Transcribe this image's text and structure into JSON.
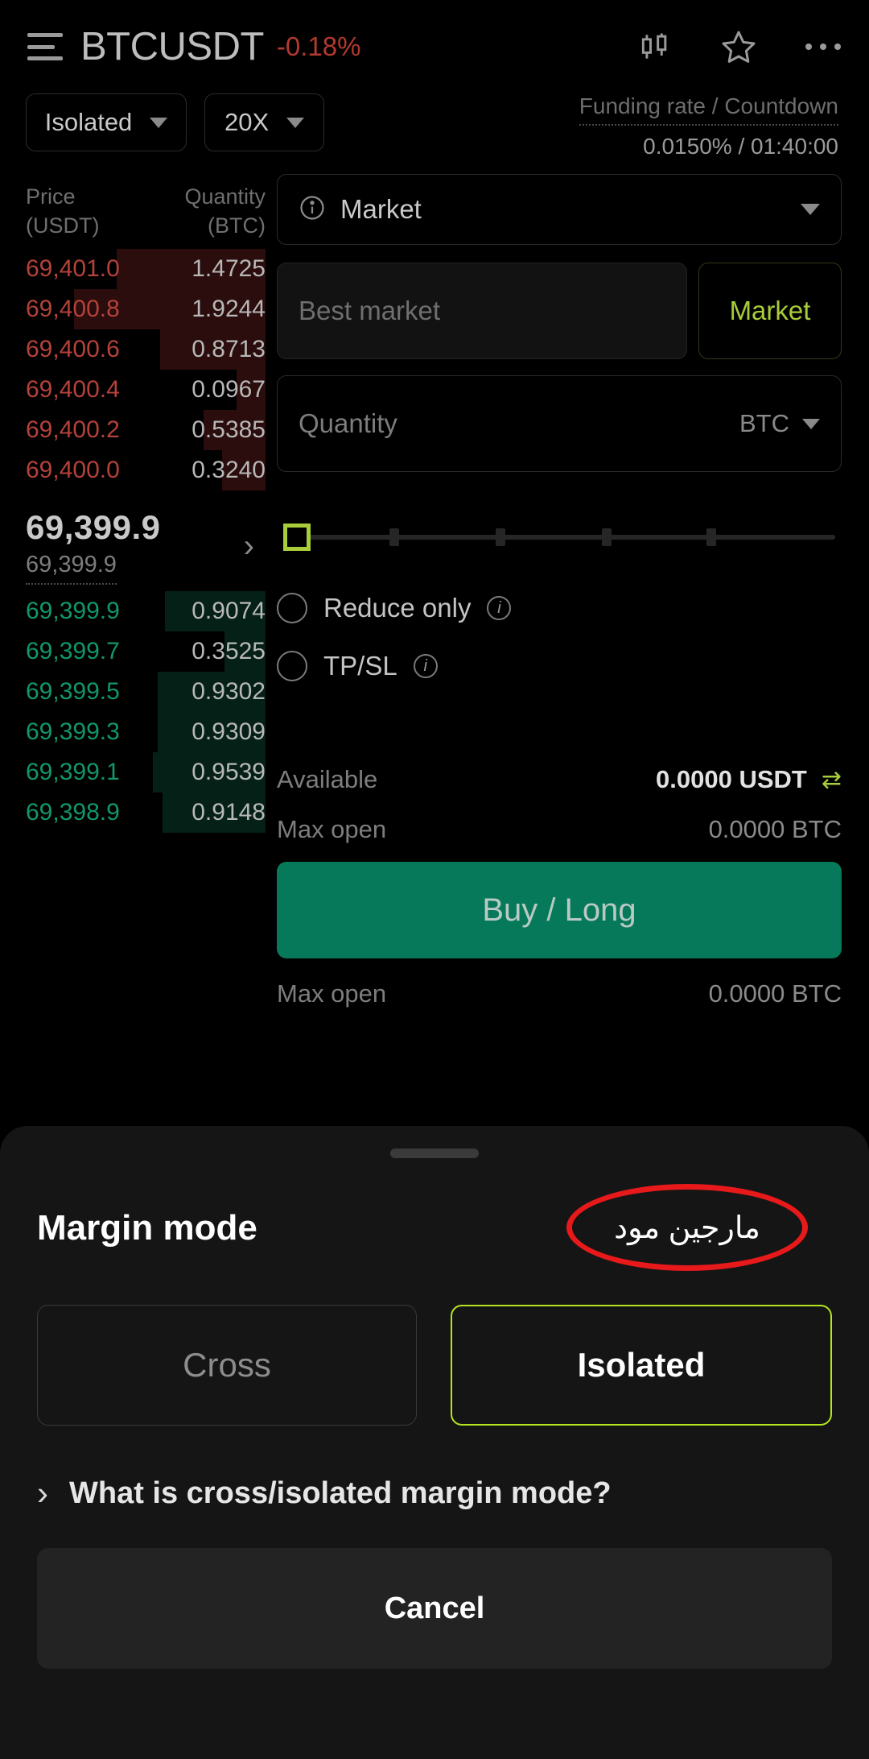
{
  "header": {
    "menu_icon": "hamburger-icon",
    "symbol": "BTCUSDT",
    "change": "-0.18%",
    "chart_icon": "candlestick-icon",
    "favorite_icon": "star-icon",
    "more_icon": "more-horizontal-icon"
  },
  "controls": {
    "margin_mode": "Isolated",
    "leverage": "20X",
    "funding_label": "Funding rate / Countdown",
    "funding_value": "0.0150% / 01:40:00"
  },
  "orderbook": {
    "price_header": "Price",
    "price_unit": "(USDT)",
    "qty_header": "Quantity",
    "qty_unit": "(BTC)",
    "asks": [
      {
        "price": "69,401.0",
        "qty": "1.4725",
        "depth": 62
      },
      {
        "price": "69,400.8",
        "qty": "1.9244",
        "depth": 80
      },
      {
        "price": "69,400.6",
        "qty": "0.8713",
        "depth": 44
      },
      {
        "price": "69,400.4",
        "qty": "0.0967",
        "depth": 12
      },
      {
        "price": "69,400.2",
        "qty": "0.5385",
        "depth": 26
      },
      {
        "price": "69,400.0",
        "qty": "0.3240",
        "depth": 18
      }
    ],
    "mid_price_large": "69,399.9",
    "mid_price_small": "69,399.9",
    "mid_chevron": "chevron-right-icon",
    "bids": [
      {
        "price": "69,399.9",
        "qty": "0.9074",
        "depth": 42
      },
      {
        "price": "69,399.7",
        "qty": "0.3525",
        "depth": 17
      },
      {
        "price": "69,399.5",
        "qty": "0.9302",
        "depth": 45
      },
      {
        "price": "69,399.3",
        "qty": "0.9309",
        "depth": 45
      },
      {
        "price": "69,399.1",
        "qty": "0.9539",
        "depth": 47
      },
      {
        "price": "69,398.9",
        "qty": "0.9148",
        "depth": 43
      }
    ]
  },
  "form": {
    "order_type": "Market",
    "order_type_info_icon": "info-icon",
    "price_placeholder": "Best market",
    "market_button": "Market",
    "quantity_placeholder": "Quantity",
    "quantity_unit": "BTC",
    "slider_value": 0,
    "slider_ticks": [
      25,
      50,
      75,
      100
    ],
    "reduce_only": "Reduce only",
    "reduce_only_info_icon": "info-icon",
    "tpsl": "TP/SL",
    "tpsl_info_icon": "info-icon",
    "available_label": "Available",
    "available_value": "0.0000 USDT",
    "swap_icon": "swap-arrows-icon",
    "max_open_label": "Max open",
    "max_open_value": "0.0000  BTC",
    "buy_button": "Buy / Long",
    "max_open_label2": "Max open",
    "max_open_value2": "0.0000  BTC"
  },
  "sheet": {
    "title": "Margin mode",
    "annotation": "مارجین مود",
    "annotation_color": "#e8191a",
    "cross_label": "Cross",
    "isolated_label": "Isolated",
    "selected_mode": "Isolated",
    "accent_color": "#b5e61d",
    "help_chevron_icon": "chevron-right-icon",
    "help_text": "What is cross/isolated margin mode?",
    "cancel_label": "Cancel"
  }
}
